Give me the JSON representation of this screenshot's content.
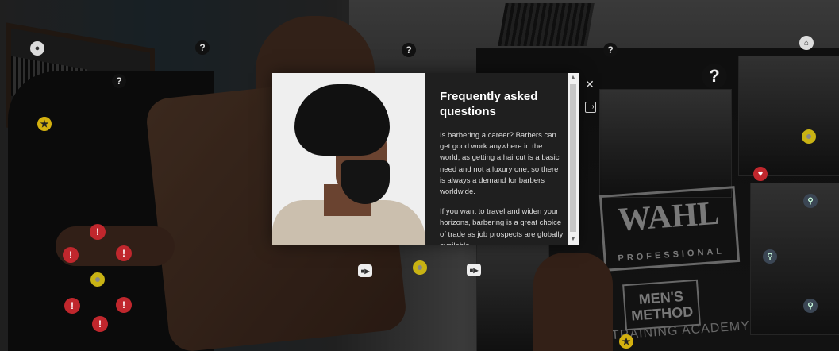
{
  "modal": {
    "title": "Frequently asked questions",
    "paragraph_1": "Is barbering a career? Barbers can get good work anywhere in the world, as getting a haircut is a basic need and not a luxury one, so there is always a demand for barbers worldwide.",
    "paragraph_2": "If you want to travel and widen your horizons, barbering is a great choice of trade as job prospects are globally available.",
    "close_icon": "close-icon",
    "audio_icon": "audio-description-icon"
  },
  "scene": {
    "wahl_text": "WAHL",
    "wahl_sub": "PROFESSIONAL",
    "mens_method": "MEN'S METHOD",
    "academy": "TRAINING ACADEMY"
  },
  "hotspots": {
    "info": "?",
    "warn": "!",
    "star": "★",
    "heart": "♥",
    "search": "⚲",
    "home": "⌂",
    "location": "⬤"
  }
}
